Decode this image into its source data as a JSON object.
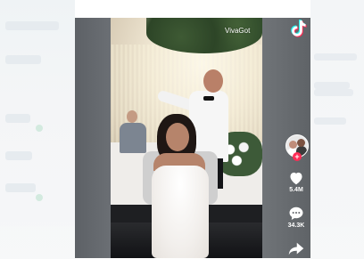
{
  "video": {
    "watermark": "VivaGot"
  },
  "actions": {
    "likes": "5.4M",
    "comments": "34.3K"
  },
  "icons": {
    "brand": "tiktok-logo",
    "like": "heart-icon",
    "comment": "comment-icon",
    "share": "share-icon",
    "follow": "plus-icon"
  },
  "colors": {
    "brand_pink": "#fe2c55",
    "brand_cyan": "#25f4ee"
  }
}
